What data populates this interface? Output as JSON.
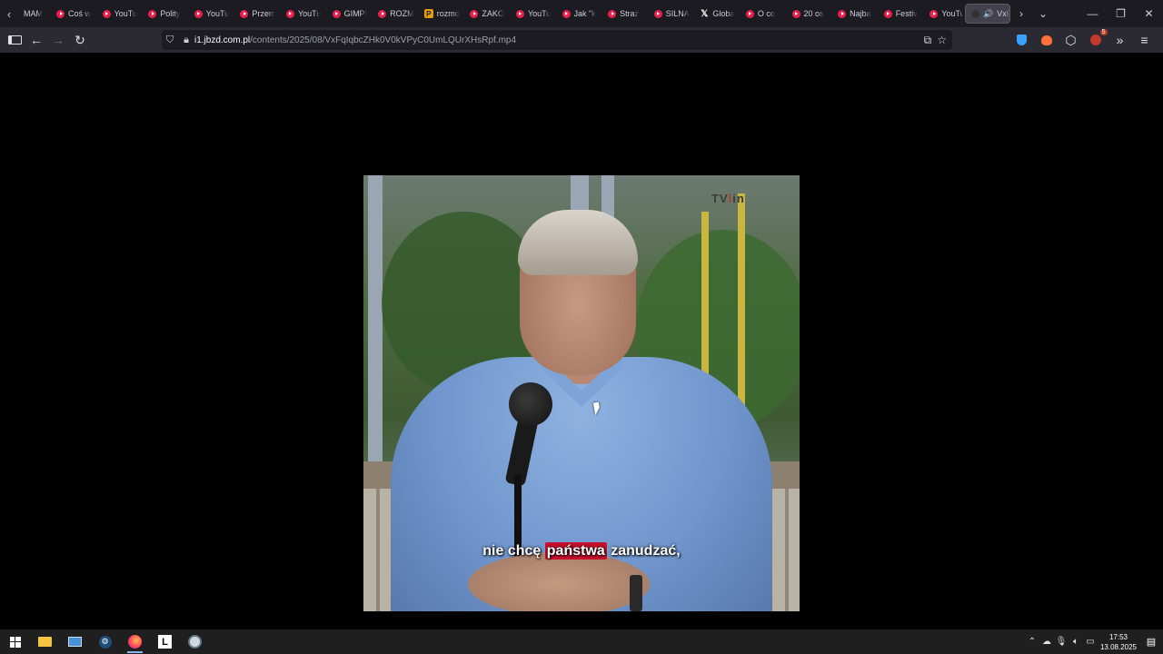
{
  "tabs": [
    {
      "label": "MAM",
      "icon": "none-icon"
    },
    {
      "label": "Coś w",
      "icon": "youtube-icon"
    },
    {
      "label": "YouTu",
      "icon": "youtube-icon"
    },
    {
      "label": "Polity",
      "icon": "youtube-icon"
    },
    {
      "label": "YouTu",
      "icon": "youtube-icon"
    },
    {
      "label": "Przem",
      "icon": "youtube-icon"
    },
    {
      "label": "YouTu",
      "icon": "youtube-icon"
    },
    {
      "label": "GIMPI",
      "icon": "youtube-icon"
    },
    {
      "label": "ROZM",
      "icon": "youtube-icon"
    },
    {
      "label": "rozmo",
      "icon": "p-site-icon"
    },
    {
      "label": "ZAKO",
      "icon": "youtube-icon"
    },
    {
      "label": "YouTu",
      "icon": "youtube-icon"
    },
    {
      "label": "Jak \"k",
      "icon": "youtube-icon"
    },
    {
      "label": "Straż",
      "icon": "youtube-icon"
    },
    {
      "label": "SILNA",
      "icon": "youtube-icon"
    },
    {
      "label": "Globa",
      "icon": "x-icon"
    },
    {
      "label": "O co",
      "icon": "youtube-icon"
    },
    {
      "label": "20 os",
      "icon": "youtube-icon"
    },
    {
      "label": "Najba",
      "icon": "youtube-icon"
    },
    {
      "label": "Festiv",
      "icon": "youtube-icon"
    },
    {
      "label": "YouTu",
      "icon": "youtube-icon"
    }
  ],
  "active_tab": {
    "label": "VxF",
    "icon": "media-icon"
  },
  "address": {
    "host": "i1.jbzd.com.pl",
    "path": "/contents/2025/08/VxFqIqbcZHk0V0kVPyC0UmLQUrXHsRpf.mp4"
  },
  "video": {
    "subtitle_before": "nie chcę",
    "subtitle_highlight": "państwa",
    "subtitle_after": "zanudzać,",
    "logo_prefix": "TV",
    "logo_red": "l",
    "logo_suffix": "in"
  },
  "extensions": {
    "badge_count": "5"
  },
  "taskbar": {
    "time": "17:53",
    "date": "13.08.2025"
  },
  "colors": {
    "tabstrip_bg": "#1c1b22",
    "toolbar_bg": "#2b2a33",
    "subtitle_highlight": "#c8102e",
    "youtube_red": "#e8204a"
  }
}
